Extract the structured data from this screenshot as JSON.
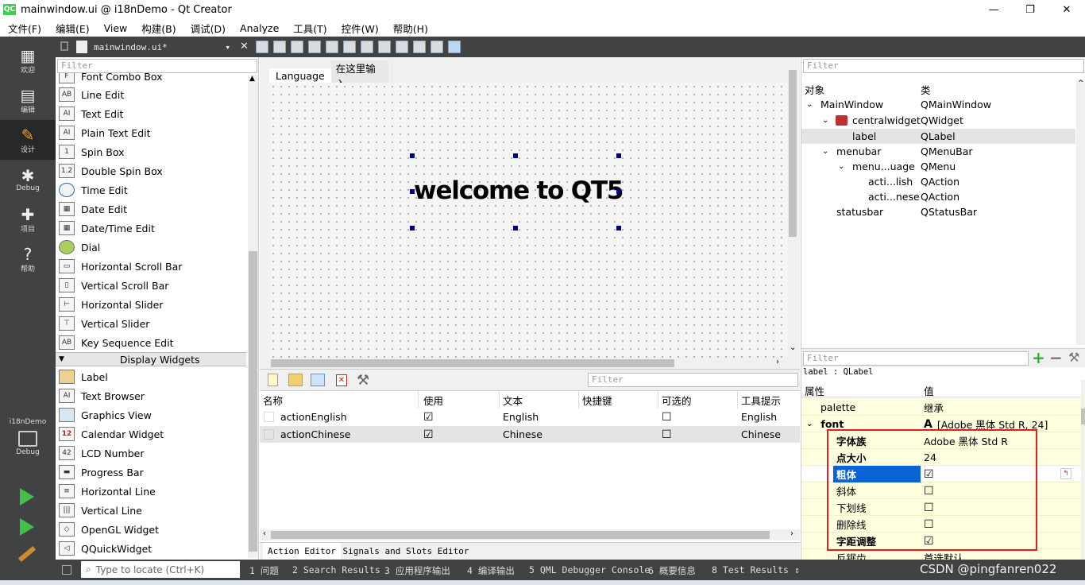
{
  "window": {
    "title": "mainwindow.ui @ i18nDemo - Qt Creator",
    "minimize": "—",
    "maximize": "❐",
    "close": "✕"
  },
  "menu": [
    "文件(F)",
    "编辑(E)",
    "View",
    "构建(B)",
    "调试(D)",
    "Analyze",
    "工具(T)",
    "控件(W)",
    "帮助(H)"
  ],
  "modes": [
    {
      "icon": "▦",
      "label": "欢迎"
    },
    {
      "icon": "▤",
      "label": "编辑"
    },
    {
      "icon": "✎",
      "label": "设计"
    },
    {
      "icon": "✱",
      "label": "Debug"
    },
    {
      "icon": "✚",
      "label": "项目"
    },
    {
      "icon": "?",
      "label": "帮助"
    }
  ],
  "kit": {
    "project": "i18nDemo",
    "config": "Debug"
  },
  "editor_tab": "mainwindow.ui*",
  "widgetbox": {
    "filter_placeholder": "Filter",
    "items_a": [
      "Font Combo Box",
      "Line Edit",
      "Text Edit",
      "Plain Text Edit",
      "Spin Box",
      "Double Spin Box",
      "Time Edit",
      "Date Edit",
      "Date/Time Edit",
      "Dial",
      "Horizontal Scroll Bar",
      "Vertical Scroll Bar",
      "Horizontal Slider",
      "Vertical Slider",
      "Key Sequence Edit"
    ],
    "section": "Display Widgets",
    "items_b": [
      "Label",
      "Text Browser",
      "Graphics View",
      "Calendar Widget",
      "LCD Number",
      "Progress Bar",
      "Horizontal Line",
      "Vertical Line",
      "OpenGL Widget",
      "QQuickWidget"
    ]
  },
  "form": {
    "menu_language": "Language",
    "menu_type_here": "在这里输入",
    "label_text": "welcome to QT5"
  },
  "action_editor": {
    "filter_placeholder": "Filter",
    "headers": [
      "名称",
      "使用",
      "文本",
      "快捷键",
      "可选的",
      "工具提示"
    ],
    "rows": [
      {
        "name": "actionEnglish",
        "used": "☑",
        "text": "English",
        "shortcut": "",
        "checkable": "☐",
        "tooltip": "English"
      },
      {
        "name": "actionChinese",
        "used": "☑",
        "text": "Chinese",
        "shortcut": "",
        "checkable": "☐",
        "tooltip": "Chinese"
      }
    ],
    "tabs": [
      "Action Editor",
      "Signals and Slots Editor"
    ]
  },
  "object_inspector": {
    "filter_placeholder": "Filter",
    "headers": [
      "对象",
      "类"
    ],
    "rows": [
      {
        "name": "MainWindow",
        "cls": "QMainWindow"
      },
      {
        "name": "centralwidget",
        "cls": "QWidget"
      },
      {
        "name": "label",
        "cls": "QLabel"
      },
      {
        "name": "menubar",
        "cls": "QMenuBar"
      },
      {
        "name": "menu...uage",
        "cls": "QMenu"
      },
      {
        "name": "acti...lish",
        "cls": "QAction"
      },
      {
        "name": "acti...nese",
        "cls": "QAction"
      },
      {
        "name": "statusbar",
        "cls": "QStatusBar"
      }
    ]
  },
  "property_editor": {
    "filter_placeholder": "Filter",
    "context": "label : QLabel",
    "headers": [
      "属性",
      "值"
    ],
    "rows": [
      {
        "name": "palette",
        "value": "继承"
      },
      {
        "name": "font",
        "value": "[Adobe 黑体 Std R, 24]"
      },
      {
        "name": "字体族",
        "value": "Adobe 黑体 Std R"
      },
      {
        "name": "点大小",
        "value": "24"
      },
      {
        "name": "粗体",
        "value": "☑"
      },
      {
        "name": "斜体",
        "value": "☐"
      },
      {
        "name": "下划线",
        "value": "☐"
      },
      {
        "name": "删除线",
        "value": "☐"
      },
      {
        "name": "字距调整",
        "value": "☑"
      },
      {
        "name": "反锯齿",
        "value": "首选默认"
      }
    ],
    "font_glyph": "A",
    "highlight_color": "#e02020"
  },
  "statusbar": {
    "locate_placeholder": "Type to locate (Ctrl+K)",
    "panes": [
      "1 问题",
      "2 Search Results",
      "3 应用程序输出",
      "4 编译输出",
      "5 QML Debugger Console",
      "6 概要信息",
      "8 Test Results"
    ]
  },
  "watermark": "CSDN @pingfanren022"
}
